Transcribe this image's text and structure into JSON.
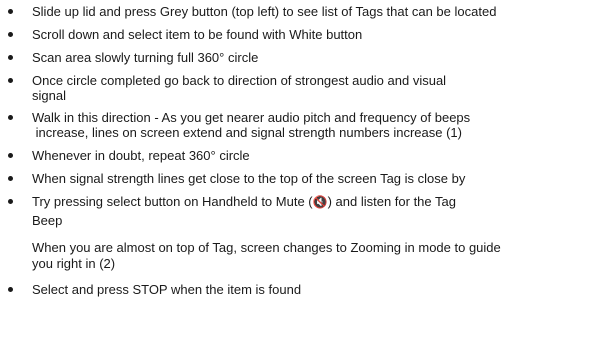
{
  "colors": {
    "text": "#1a1a1a",
    "background": "#ffffff"
  },
  "instructions": [
    {
      "bullet": true,
      "text": "Slide up lid and press Grey button (top left) to see list of Tags that can be located"
    },
    {
      "bullet": true,
      "text": "Scroll down and select item to be found with White button"
    },
    {
      "bullet": true,
      "text": "Scan area slowly turning full 360° circle"
    },
    {
      "bullet": true,
      "line1": "Once circle completed go back to direction of strongest audio and visual",
      "line2": "signal"
    },
    {
      "bullet": true,
      "line1": "Walk in this direction - As you get nearer audio pitch and frequency of beeps",
      "line2": " increase, lines on screen extend and signal strength numbers increase (1)"
    },
    {
      "bullet": true,
      "text": "Whenever in doubt, repeat 360° circle"
    },
    {
      "bullet": true,
      "text": "When signal strength lines get close to the top of the screen Tag is close by"
    },
    {
      "bullet": true,
      "line1_before": "Try pressing select button on Handheld to Mute (",
      "mute_icon": "mute-speaker-icon",
      "mute_glyph": "🔇",
      "line1_after": ") and listen for the Tag",
      "line2": "Beep"
    },
    {
      "bullet": false,
      "line1": "When you are almost on top of Tag, screen changes to Zooming in mode to guide",
      "line2": "you right in (2)"
    },
    {
      "bullet": true,
      "text": "Select and press STOP when the item is found"
    }
  ]
}
